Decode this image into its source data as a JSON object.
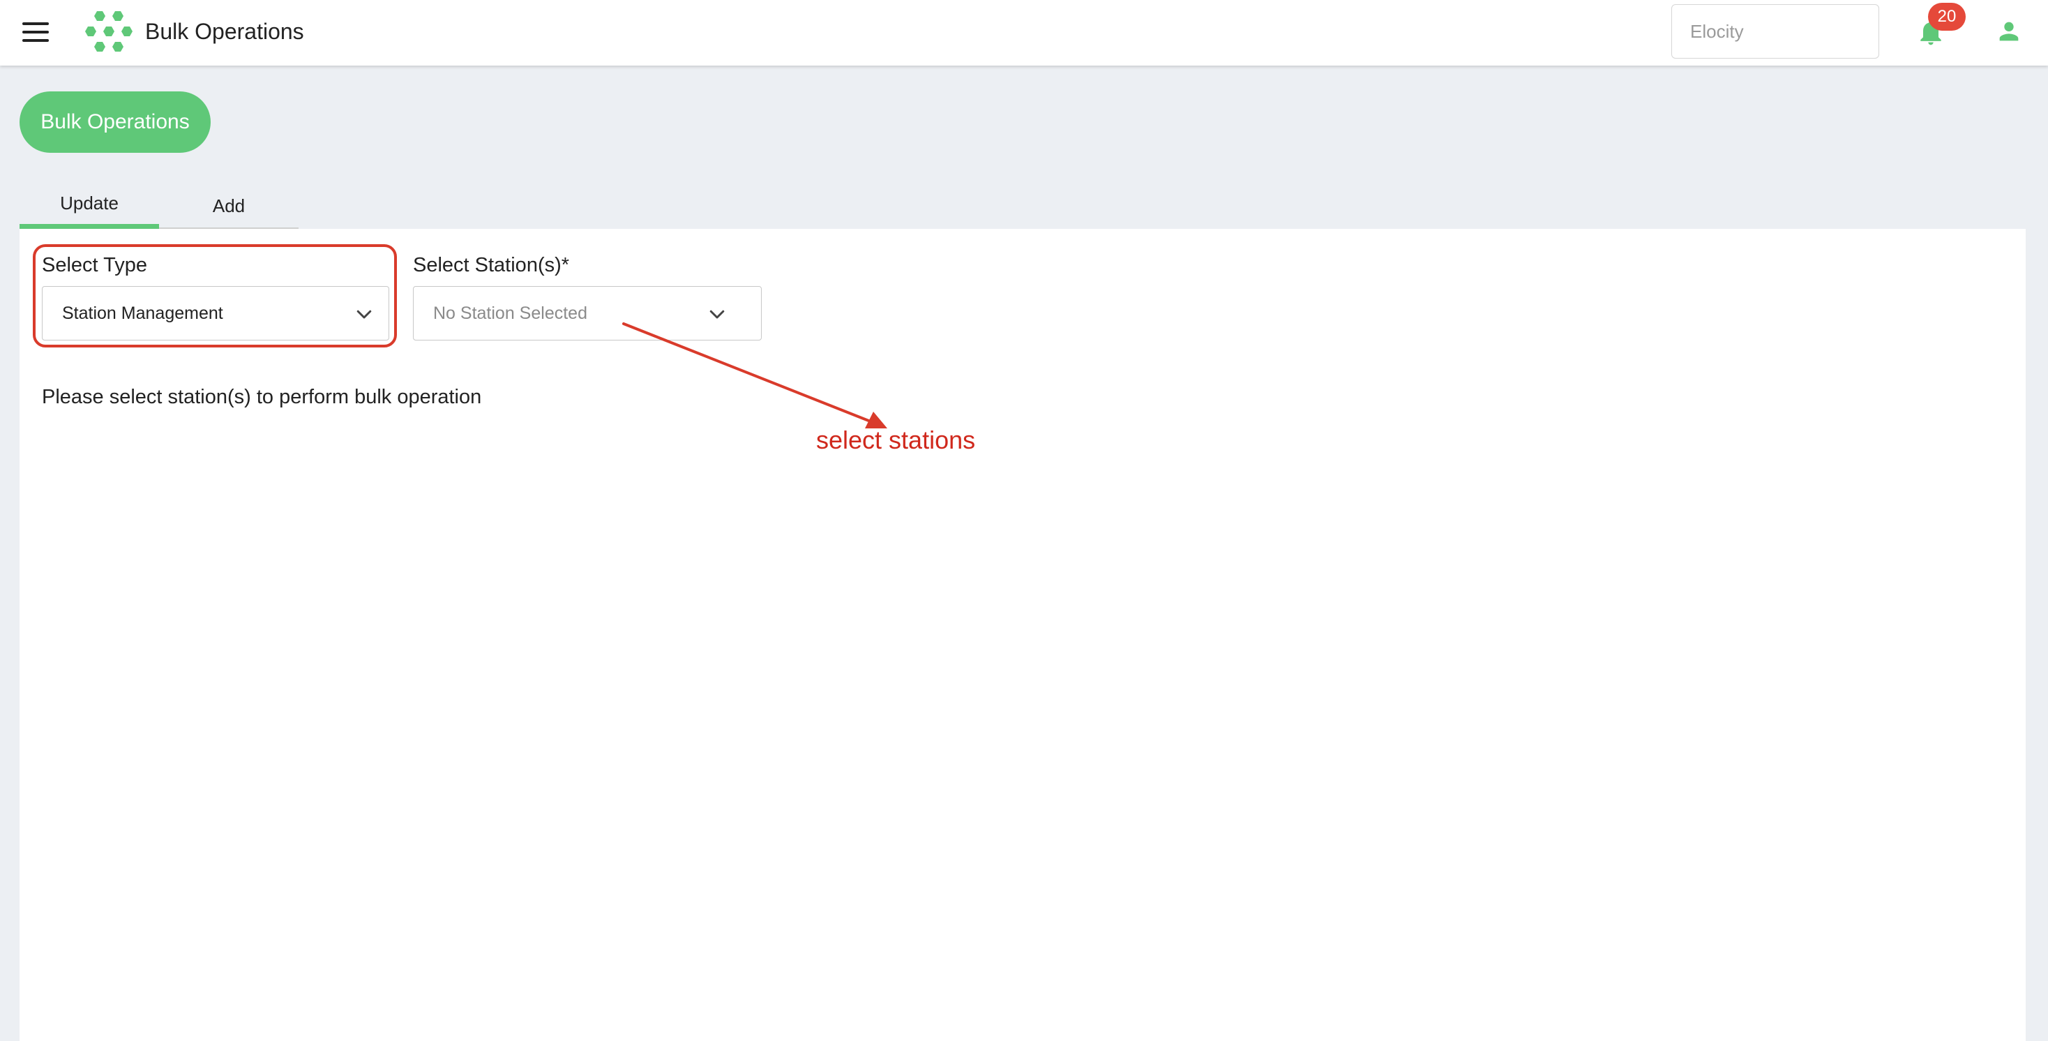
{
  "header": {
    "title": "Bulk Operations",
    "org_placeholder": "Elocity",
    "notification_count": "20"
  },
  "page": {
    "pill_label": "Bulk Operations",
    "tabs": [
      {
        "label": "Update",
        "active": true
      },
      {
        "label": "Add",
        "active": false
      }
    ],
    "select_type": {
      "label": "Select Type",
      "value": "Station Management"
    },
    "select_stations": {
      "label": "Select Station(s)*",
      "placeholder": "No Station Selected"
    },
    "helper_text": "Please select station(s) to perform bulk operation"
  },
  "annotation": {
    "text": "select stations"
  },
  "colors": {
    "accent": "#5fc878",
    "badge": "#e5493a",
    "annotation": "#d93b2b"
  }
}
